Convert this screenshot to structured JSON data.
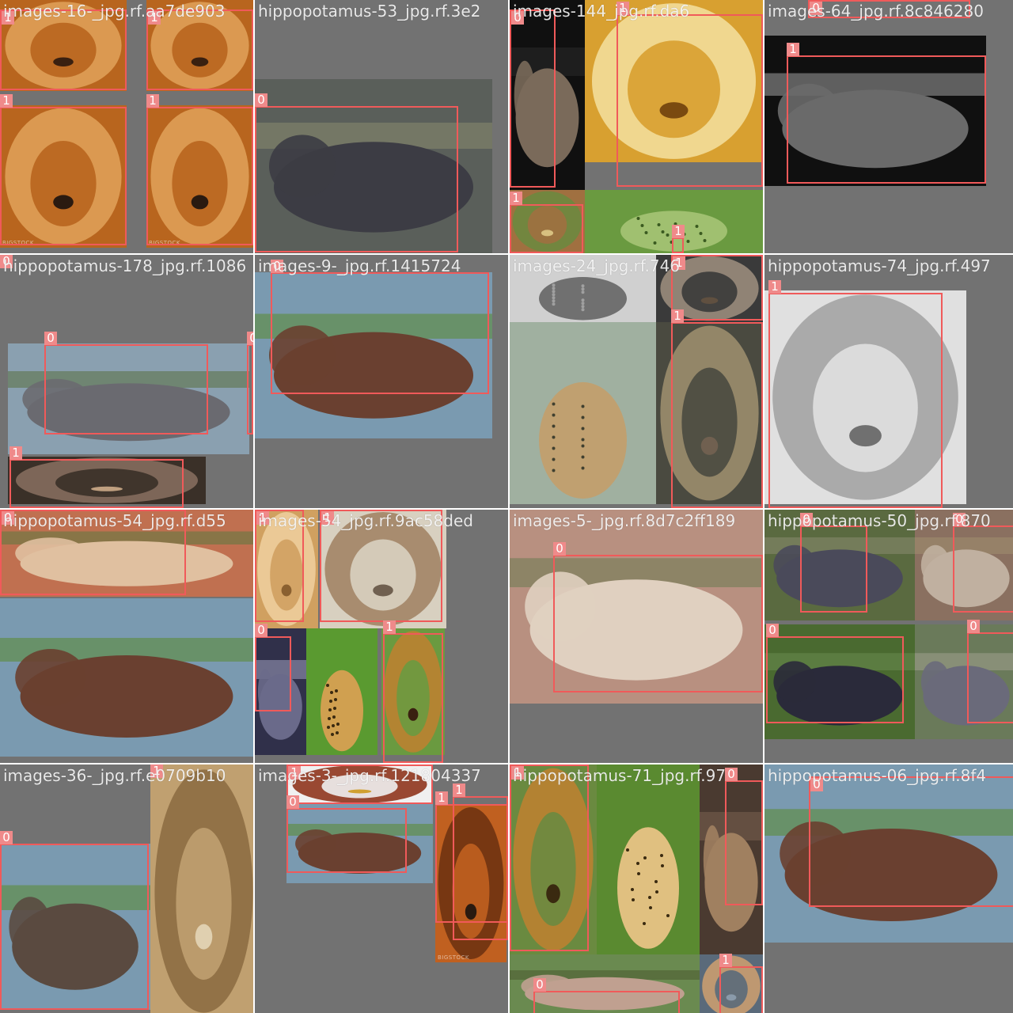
{
  "mosaic": {
    "background": "#ffffff",
    "box_color": "#f05a5a",
    "tag_color": "#ef8a8a",
    "tiles": [
      {
        "title": "images-16-_jpg.rf.aa7de903",
        "photos": [
          {
            "w": 160,
            "h": 115,
            "colors": [
              "#b8651e",
              "#e0a25a",
              "#3a2010"
            ],
            "kind": "lion"
          },
          {
            "w": 135,
            "h": 115,
            "colors": [
              "#b8651e",
              "#e0a25a",
              "#3a2010"
            ],
            "kind": "lion"
          },
          {
            "w": 160,
            "h": 180,
            "colors": [
              "#b8651e",
              "#e0a25a",
              "#2a1a10"
            ],
            "kind": "lion",
            "label": "BIGSTOCK"
          },
          {
            "w": 135,
            "h": 180,
            "colors": [
              "#b8651e",
              "#e0a25a",
              "#2a1a10"
            ],
            "kind": "lion",
            "label": "BIGSTOCK"
          }
        ],
        "boxes": [
          {
            "cls": "1"
          },
          {
            "cls": "1"
          },
          {
            "cls": "1"
          },
          {
            "cls": "1"
          }
        ]
      },
      {
        "title": "hippopotamus-53_jpg.rf.3e2",
        "photos": [
          {
            "w": 300,
            "h": 220,
            "colors": [
              "#5a5f5a",
              "#3c3c44",
              "#8a8a70"
            ],
            "kind": "hippo"
          }
        ],
        "boxes": [
          {
            "cls": "0"
          }
        ]
      },
      {
        "title": "images-144_jpg.rf.da6",
        "photos": [
          {
            "w": 95,
            "h": 240,
            "colors": [
              "#101010",
              "#7a6a5a",
              "#2a2a2a"
            ],
            "kind": "hippo"
          },
          {
            "w": 225,
            "h": 205,
            "colors": [
              "#d8a030",
              "#f4e0a0",
              "#7a4a10"
            ],
            "kind": "lion"
          },
          {
            "w": 95,
            "h": 80,
            "colors": [
              "#a07040",
              "#6a8a40",
              "#d8c080"
            ],
            "kind": "lion"
          },
          {
            "w": 225,
            "h": 80,
            "colors": [
              "#6a9a40",
              "#a0c070",
              "#3a5a20"
            ],
            "kind": "cheetah"
          }
        ],
        "boxes": [
          {
            "cls": "0"
          },
          {
            "cls": "1"
          },
          {
            "cls": "1"
          },
          {
            "cls": "1"
          }
        ]
      },
      {
        "title": "images-64_jpg.rf.8c846280",
        "photos": [
          {
            "w": 280,
            "h": 190,
            "colors": [
              "#101010",
              "#6a6a6a",
              "#a0a0a0"
            ],
            "kind": "hippo"
          }
        ],
        "boxes": [
          {
            "cls": "1"
          },
          {
            "cls": "0"
          }
        ]
      },
      {
        "title": "hippopotamus-178_jpg.rf.1086",
        "photos": [
          {
            "w": 305,
            "h": 140,
            "colors": [
              "#8aa0b0",
              "#6a6a70",
              "#5a7040"
            ],
            "kind": "hippo"
          },
          {
            "w": 250,
            "h": 60,
            "colors": [
              "#3a3028",
              "#8a7060",
              "#c0a080"
            ],
            "kind": "lion"
          }
        ],
        "boxes": [
          {
            "cls": "0"
          },
          {
            "cls": "0"
          },
          {
            "cls": "1"
          },
          {
            "cls": "0"
          }
        ]
      },
      {
        "title": "images-9-_jpg.rf.1415724",
        "photos": [
          {
            "w": 300,
            "h": 210,
            "colors": [
              "#7a9ab0",
              "#6a4030",
              "#5a8a30"
            ],
            "kind": "hippo"
          }
        ],
        "boxes": [
          {
            "cls": "0"
          }
        ]
      },
      {
        "title": "images-24_jpg.rf.746",
        "photos": [
          {
            "w": 185,
            "h": 85,
            "colors": [
              "#d0d0d0",
              "#707070",
              "#a0a0a0"
            ],
            "kind": "cheetah"
          },
          {
            "w": 135,
            "h": 85,
            "colors": [
              "#3a3a3a",
              "#a09080",
              "#605040"
            ],
            "kind": "lion"
          },
          {
            "w": 185,
            "h": 230,
            "colors": [
              "#a0b0a0",
              "#c0a070",
              "#404030"
            ],
            "kind": "cheetah"
          },
          {
            "w": 135,
            "h": 230,
            "colors": [
              "#4a4a40",
              "#a09070",
              "#706050"
            ],
            "kind": "lion"
          }
        ],
        "boxes": [
          {
            "cls": "1"
          },
          {
            "cls": "1"
          }
        ]
      },
      {
        "title": "hippopotamus-74_jpg.rf.497",
        "photos": [
          {
            "w": 255,
            "h": 270,
            "colors": [
              "#e0e0e0",
              "#a0a0a0",
              "#707070"
            ],
            "kind": "lion"
          }
        ],
        "boxes": [
          {
            "cls": "1"
          }
        ]
      },
      {
        "title": "hippopotamus-54_jpg.rf.d55",
        "photos": [
          {
            "w": 320,
            "h": 110,
            "colors": [
              "#c07050",
              "#e0c0a0",
              "#5a7a40"
            ],
            "kind": "hippo"
          },
          {
            "w": 320,
            "h": 200,
            "colors": [
              "#7a9ab0",
              "#6a4030",
              "#5a8a30"
            ],
            "kind": "hippo"
          }
        ],
        "boxes": [
          {
            "cls": "0"
          }
        ]
      },
      {
        "title": "images-54_jpg.rf.9ac58ded",
        "photos": [
          {
            "w": 80,
            "h": 150,
            "colors": [
              "#d0a060",
              "#f0d0a0",
              "#8a6030"
            ],
            "kind": "lion"
          },
          {
            "w": 160,
            "h": 150,
            "colors": [
              "#d8d0c0",
              "#a08060",
              "#706050"
            ],
            "kind": "lion"
          },
          {
            "w": 65,
            "h": 160,
            "colors": [
              "#30304a",
              "#6a6a8a",
              "#a0a0c0"
            ],
            "kind": "hippo"
          },
          {
            "w": 90,
            "h": 160,
            "colors": [
              "#5a9a30",
              "#d0a050",
              "#3a2a10"
            ],
            "kind": "cheetah"
          },
          {
            "w": 80,
            "h": 160,
            "colors": [
              "#6a9a40",
              "#c08030",
              "#3a2010"
            ],
            "kind": "lion"
          }
        ],
        "boxes": [
          {
            "cls": "1"
          },
          {
            "cls": "1"
          },
          {
            "cls": "0"
          },
          {
            "cls": "1"
          }
        ]
      },
      {
        "title": "images-5-_jpg.rf.8d7c2ff189",
        "photos": [
          {
            "w": 320,
            "h": 245,
            "colors": [
              "#b89080",
              "#e0d0c0",
              "#6a7a50"
            ],
            "kind": "hippo"
          }
        ],
        "boxes": [
          {
            "cls": "0"
          }
        ]
      },
      {
        "title": "hippopotamus-50_jpg.rf.870",
        "photos": [
          {
            "w": 190,
            "h": 140,
            "colors": [
              "#5a6a40",
              "#4a4a5a",
              "#8a8a70"
            ],
            "kind": "hippo"
          },
          {
            "w": 130,
            "h": 140,
            "colors": [
              "#8a7060",
              "#c0b0a0",
              "#a09070"
            ],
            "kind": "hippo"
          },
          {
            "w": 190,
            "h": 145,
            "colors": [
              "#4a6a30",
              "#2a2a3a",
              "#6a8a50"
            ],
            "kind": "hippo"
          },
          {
            "w": 130,
            "h": 145,
            "colors": [
              "#6a7a5a",
              "#6a6a7a",
              "#a0a090"
            ],
            "kind": "hippo"
          }
        ],
        "boxes": [
          {
            "cls": "0"
          },
          {
            "cls": "0"
          },
          {
            "cls": "0"
          },
          {
            "cls": "0"
          }
        ]
      },
      {
        "title": "images-36-_jpg.rf.e0709b10",
        "photos": [
          {
            "w": 190,
            "h": 210,
            "colors": [
              "#7a9ab0",
              "#5a4a40",
              "#5a8a30"
            ],
            "kind": "hippo"
          },
          {
            "w": 135,
            "h": 320,
            "colors": [
              "#c0a070",
              "#8a6a40",
              "#e0d0b0"
            ],
            "kind": "lion"
          }
        ],
        "boxes": [
          {
            "cls": "0"
          },
          {
            "cls": "1"
          }
        ]
      },
      {
        "title": "images-3-_jpg.rf.121804337",
        "photos": [
          {
            "w": 185,
            "h": 50,
            "colors": [
              "#f0f0f0",
              "#8a2a10",
              "#d0a030"
            ],
            "kind": "lion"
          },
          {
            "w": 185,
            "h": 100,
            "colors": [
              "#7a9ab0",
              "#6a4030",
              "#5a8a30"
            ],
            "kind": "hippo"
          },
          {
            "w": 90,
            "h": 200,
            "colors": [
              "#c06020",
              "#6a3010",
              "#2a1a10"
            ],
            "kind": "lion",
            "label": "BIGSTOCK"
          }
        ],
        "boxes": [
          {
            "cls": "1"
          },
          {
            "cls": "0"
          },
          {
            "cls": "1"
          },
          {
            "cls": "1"
          }
        ]
      },
      {
        "title": "hippopotamus-71_jpg.rf.97",
        "photos": [
          {
            "w": 110,
            "h": 240,
            "colors": [
              "#6a8a40",
              "#c08030",
              "#3a2a10"
            ],
            "kind": "lion"
          },
          {
            "w": 130,
            "h": 240,
            "colors": [
              "#5a8a30",
              "#e0c080",
              "#3a2a10"
            ],
            "kind": "cheetah"
          },
          {
            "w": 80,
            "h": 240,
            "colors": [
              "#4a3a30",
              "#a08060",
              "#7a6050"
            ],
            "kind": "hippo"
          },
          {
            "w": 240,
            "h": 80,
            "colors": [
              "#6a8a50",
              "#c0a090",
              "#4a5a30"
            ],
            "kind": "hippo"
          },
          {
            "w": 80,
            "h": 80,
            "colors": [
              "#5a6a7a",
              "#d0a070",
              "#8a9aaa"
            ],
            "kind": "lion"
          }
        ],
        "boxes": [
          {
            "cls": "1"
          },
          {
            "cls": "0"
          },
          {
            "cls": "0"
          },
          {
            "cls": "1"
          }
        ]
      },
      {
        "title": "hippopotamus-06_jpg.rf.8f4",
        "photos": [
          {
            "w": 320,
            "h": 225,
            "colors": [
              "#7a9ab0",
              "#6a4030",
              "#5a8a30"
            ],
            "kind": "hippo"
          }
        ],
        "boxes": [
          {
            "cls": "0"
          }
        ]
      }
    ]
  }
}
